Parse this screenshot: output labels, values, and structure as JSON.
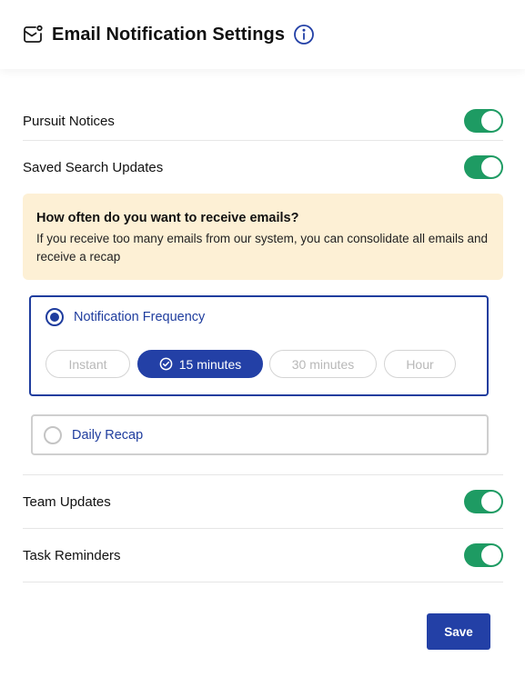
{
  "header": {
    "title": "Email Notification Settings",
    "icon": "mail-notification-icon",
    "info_icon": "info-icon"
  },
  "settings": [
    {
      "label": "Pursuit Notices",
      "enabled": true
    },
    {
      "label": "Saved Search Updates",
      "enabled": true
    },
    {
      "label": "Team Updates",
      "enabled": true
    },
    {
      "label": "Task Reminders",
      "enabled": true
    }
  ],
  "notice": {
    "question": "How often do you want to receive emails?",
    "description": "If you receive too many emails from our system, you can consolidate all emails and receive a recap"
  },
  "frequency": {
    "option_label": "Notification Frequency",
    "selected": true,
    "chips": [
      {
        "label": "Instant",
        "active": false
      },
      {
        "label": "15 minutes",
        "active": true
      },
      {
        "label": "30 minutes",
        "active": false
      },
      {
        "label": "Hour",
        "active": false
      }
    ]
  },
  "recap": {
    "option_label": "Daily Recap",
    "selected": false
  },
  "actions": {
    "save_label": "Save"
  },
  "colors": {
    "primary": "#2340a6",
    "toggle_on": "#1e9b63",
    "notice_bg": "#fdf0d5"
  }
}
